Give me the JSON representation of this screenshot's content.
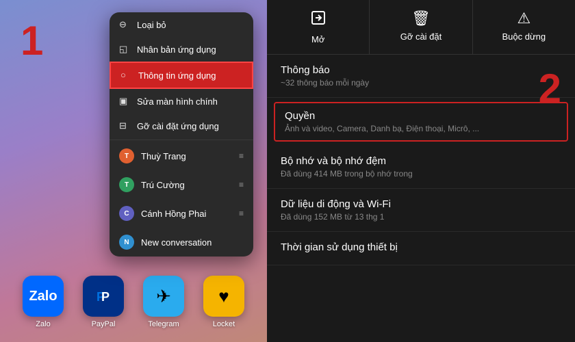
{
  "left": {
    "step_number": "1",
    "context_menu": {
      "items": [
        {
          "id": "loai-bo",
          "label": "Loại bỏ",
          "icon": "⊖",
          "type": "action"
        },
        {
          "id": "nhan-ban",
          "label": "Nhân bản ứng dụng",
          "icon": "◱",
          "type": "action"
        },
        {
          "id": "thong-tin",
          "label": "Thông tin ứng dụng",
          "icon": "○",
          "type": "action",
          "highlighted": true
        },
        {
          "id": "sua-man-hinh",
          "label": "Sửa màn hình chính",
          "icon": "▣",
          "type": "action"
        },
        {
          "id": "go-cai-dat",
          "label": "Gỡ cài đặt ứng dụng",
          "icon": "⊟",
          "type": "action"
        }
      ],
      "contacts": [
        {
          "id": "thuy-trang",
          "label": "Thuỳ Trang",
          "color": "#e06030"
        },
        {
          "id": "tru-cuong",
          "label": "Trú Cường",
          "color": "#30a060"
        },
        {
          "id": "canh-hong-phai",
          "label": "Cánh Hồng Phai",
          "color": "#6060c0"
        },
        {
          "id": "new-conversation",
          "label": "New conversation",
          "color": "#3090d0"
        }
      ]
    },
    "dock": [
      {
        "id": "zalo",
        "label": "Zalo",
        "emoji": "Z",
        "class": "zalo-icon"
      },
      {
        "id": "paypal",
        "label": "PayPal",
        "emoji": "P",
        "class": "paypal-icon"
      },
      {
        "id": "telegram",
        "label": "Telegram",
        "emoji": "✈",
        "class": "telegram-icon"
      },
      {
        "id": "locket",
        "label": "Locket",
        "emoji": "♥",
        "class": "locket-icon"
      }
    ]
  },
  "right": {
    "step_number": "2",
    "action_bar": [
      {
        "id": "mo",
        "label": "Mở",
        "icon": "✎",
        "danger": false
      },
      {
        "id": "go-cai-dat",
        "label": "Gỡ cài đặt",
        "icon": "🗑",
        "danger": false
      },
      {
        "id": "buoc-dung",
        "label": "Buộc dừng",
        "icon": "⚠",
        "danger": false
      }
    ],
    "sections": [
      {
        "id": "thong-bao",
        "title": "Thông báo",
        "subtitle": "~32 thông báo mỗi ngày",
        "highlighted": false
      },
      {
        "id": "quyen",
        "title": "Quyền",
        "subtitle": "Ảnh và video, Camera, Danh bạ, Điện thoại, Micrô, ...",
        "highlighted": true
      },
      {
        "id": "bo-nho",
        "title": "Bộ nhớ và bộ nhớ đệm",
        "subtitle": "Đã dùng 414 MB trong bộ nhớ trong",
        "highlighted": false
      },
      {
        "id": "du-lieu",
        "title": "Dữ liệu di động và Wi-Fi",
        "subtitle": "Đã dùng 152 MB từ 13 thg 1",
        "highlighted": false
      },
      {
        "id": "thoi-gian",
        "title": "Thời gian sử dụng thiết bị",
        "subtitle": "",
        "highlighted": false
      }
    ]
  }
}
